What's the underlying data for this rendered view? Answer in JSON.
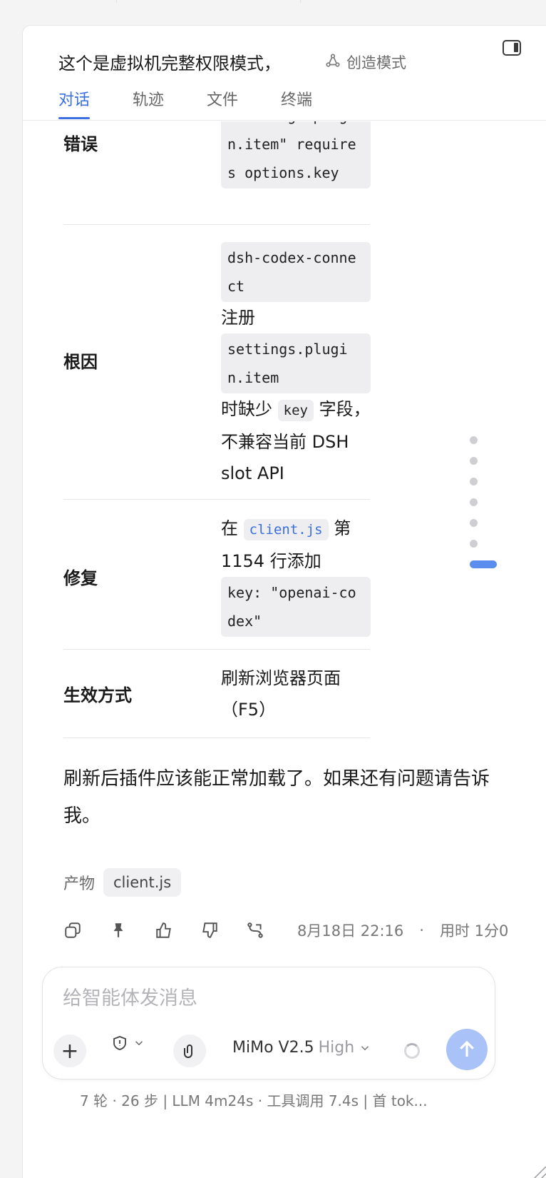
{
  "header": {
    "title": "这个是虚拟机完整权限模式，",
    "mode_label": "创造模式",
    "tabs": [
      {
        "label": "对话",
        "active": true
      },
      {
        "label": "轨迹",
        "active": false
      },
      {
        "label": "文件",
        "active": false
      },
      {
        "label": "终端",
        "active": false
      }
    ]
  },
  "table": {
    "rows": [
      {
        "label": "错误",
        "code1": "\"settings.plugin.item\" requires options.key"
      },
      {
        "label": "根因",
        "code1": "dsh-codex-connect",
        "text1": "注册",
        "code2": "settings.plugin.item",
        "text2": "时缺少",
        "inline": "key",
        "text3": "字段，不兼容当前 DSH slot API"
      },
      {
        "label": "修复",
        "text1": "在",
        "inline_link": "client.js",
        "text2": "第 1154 行添加",
        "code1": "key: \"openai-codex\""
      },
      {
        "label": "生效方式",
        "text1": "刷新浏览器页面（F5）"
      }
    ]
  },
  "summary": "刷新后插件应该能正常加载了。如果还有问题请告诉我。",
  "artifacts": {
    "label": "产物",
    "items": [
      "client.js"
    ]
  },
  "message_meta": {
    "date": "8月18日 22:16",
    "separator": "·",
    "duration": "用时 1分0"
  },
  "composer": {
    "placeholder": "给智能体发消息",
    "model_name": "MiMo V2.5",
    "model_level": "High"
  },
  "status_bar": "7 轮 · 26 步   |   LLM 4m24s · 工具调用 7.4s   |   首 tok...",
  "colors": {
    "accent": "#3a6fe0",
    "send_button": "#a9c2f7",
    "scroll_active": "#5b8def"
  }
}
